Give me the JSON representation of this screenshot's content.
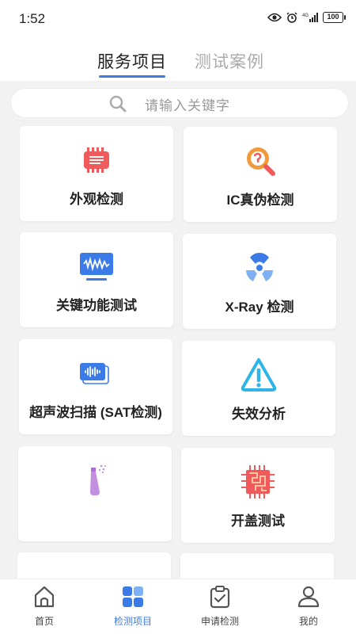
{
  "status": {
    "time": "1:52",
    "battery": "100"
  },
  "tabs": [
    {
      "label": "服务项目",
      "active": true
    },
    {
      "label": "测试案例",
      "active": false
    }
  ],
  "search": {
    "placeholder": "请输入关键字"
  },
  "services": [
    {
      "label": "外观检测",
      "icon": "chip-icon"
    },
    {
      "label": "IC真伪检测",
      "icon": "magnify-icon"
    },
    {
      "label": "关键功能测试",
      "icon": "monitor-wave-icon"
    },
    {
      "label": "X-Ray 检测",
      "icon": "radiation-icon"
    },
    {
      "label": "超声波扫描 (SAT检测)",
      "icon": "ultrasound-icon"
    },
    {
      "label": "失效分析",
      "icon": "warning-icon"
    },
    {
      "label": "",
      "icon": "spray-icon"
    },
    {
      "label": "开盖测试",
      "icon": "chip-circuit-icon"
    },
    {
      "label": "",
      "icon": "ticket-icon"
    },
    {
      "label": "",
      "icon": "stand-icon"
    }
  ],
  "tabbar": [
    {
      "label": "首页",
      "icon": "home-icon",
      "active": false
    },
    {
      "label": "检测项目",
      "icon": "grid-icon",
      "active": true
    },
    {
      "label": "申请检测",
      "icon": "clipboard-check-icon",
      "active": false
    },
    {
      "label": "我的",
      "icon": "user-icon",
      "active": false
    }
  ],
  "colors": {
    "accent": "#3b7be8",
    "red": "#f05a5a",
    "orange": "#f29a3a",
    "cyan": "#2fb4e8",
    "purple": "#c38fe0"
  }
}
